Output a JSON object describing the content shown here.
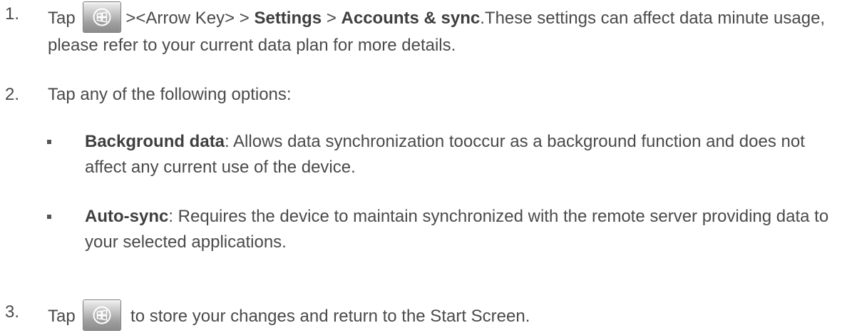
{
  "step1": {
    "number": "1.",
    "tap": "Tap",
    "icon": "windows-start-key-icon",
    "path_prefix": "><Arrow Key>  > ",
    "settings": "Settings",
    "sep": " > ",
    "accounts_sync": "Accounts & sync",
    "description": ".These settings can affect data minute usage, please refer to your current data plan for more details."
  },
  "step2": {
    "number": "2.",
    "text": "Tap any of the following options:"
  },
  "options": [
    {
      "title": "Background data",
      "description": ": Allows data synchronization tooccur as a background function and does not affect any current use of the device."
    },
    {
      "title": "Auto-sync",
      "description": ": Requires the device to maintain synchronized with the remote server providing data to your selected applications."
    }
  ],
  "step3": {
    "number": "3.",
    "tap": "Tap",
    "icon": "windows-start-key-icon",
    "text": "to store your changes and return to the Start Screen."
  }
}
